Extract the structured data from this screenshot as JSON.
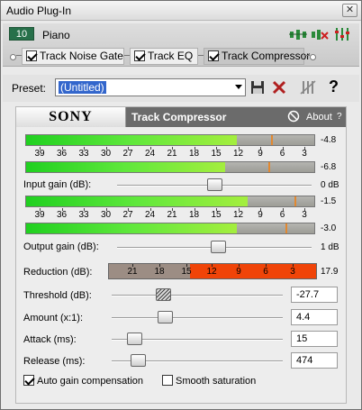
{
  "window": {
    "title": "Audio Plug-In",
    "close_glyph": "✕"
  },
  "chain": {
    "track_number": "10",
    "track_name": "Piano",
    "fx": [
      {
        "label": "Track Noise Gate",
        "checked": true,
        "active": false
      },
      {
        "label": "Track EQ",
        "checked": true,
        "active": false
      },
      {
        "label": "Track Compressor",
        "checked": true,
        "active": true
      }
    ],
    "icons": [
      "plug-in-chain-icon",
      "remove-plugin-icon",
      "mixer-settings-icon"
    ]
  },
  "preset": {
    "label": "Preset:",
    "value": "(Untitled)",
    "icons": [
      "save-icon",
      "delete-icon",
      "bypass-icon",
      "help-icon"
    ],
    "help_glyph": "?"
  },
  "plugin": {
    "brand": "SONY",
    "title": "Track Compressor",
    "about": "About",
    "help": "?"
  },
  "input_meters": {
    "top_level": 0.73,
    "top_peak": 0.85,
    "top_value": "-4.8",
    "bottom_level": 0.69,
    "bottom_peak": 0.84,
    "bottom_value": "-6.8",
    "scale": [
      "39",
      "36",
      "33",
      "30",
      "27",
      "24",
      "21",
      "18",
      "15",
      "12",
      "9",
      "6",
      "3"
    ]
  },
  "input_gain": {
    "label": "Input gain (dB):",
    "accesskey": "I",
    "value": "0 dB",
    "position": 0.5
  },
  "output_meters": {
    "top_level": 0.77,
    "top_peak": 0.93,
    "top_value": "-1.5",
    "bottom_level": 0.73,
    "bottom_peak": 0.9,
    "bottom_value": "-3.0",
    "scale": [
      "39",
      "36",
      "33",
      "30",
      "27",
      "24",
      "21",
      "18",
      "15",
      "12",
      "9",
      "6",
      "3"
    ]
  },
  "output_gain": {
    "label": "Output gain (dB):",
    "accesskey": "O",
    "value": "1 dB",
    "position": 0.52
  },
  "reduction": {
    "label": "Reduction (dB):",
    "value": "17.9",
    "level": 0.61,
    "scale_gray": [
      "21",
      "18",
      "15"
    ],
    "scale_red": [
      "12",
      "9",
      "6",
      "3"
    ]
  },
  "controls": [
    {
      "id": "threshold",
      "label": "Threshold (dB):",
      "value": "-27.7",
      "position": 0.3,
      "hatched": true
    },
    {
      "id": "amount",
      "label": "Amount (x:1):",
      "value": "4.4",
      "position": 0.31,
      "hatched": false
    },
    {
      "id": "attack",
      "label": "Attack (ms):",
      "value": "15",
      "position": 0.13,
      "hatched": false
    },
    {
      "id": "release",
      "label": "Release (ms):",
      "value": "474",
      "position": 0.15,
      "hatched": false
    }
  ],
  "options": [
    {
      "label": "Auto gain compensation",
      "checked": true
    },
    {
      "label": "Smooth saturation",
      "checked": false
    }
  ],
  "colors": {
    "meter_green": "#20d020",
    "reduction_red": "#f04408",
    "track_badge": "#27704a",
    "selection": "#3366cc"
  }
}
